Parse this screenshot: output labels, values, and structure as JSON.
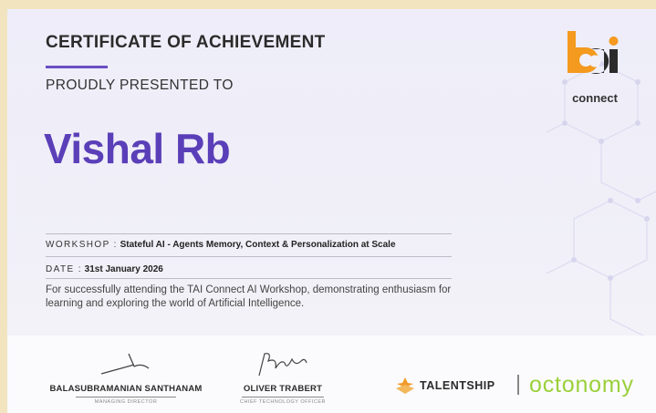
{
  "certificate": {
    "title": "CERTIFICATE OF ACHIEVEMENT",
    "subtitle": "PROUDLY PRESENTED TO",
    "recipient": "Vishal Rb",
    "workshop_label": "WORKSHOP :",
    "workshop_value": "Stateful AI - Agents Memory, Context & Personalization at Scale",
    "date_label": "DATE :",
    "date_value": "31st January 2026",
    "description": "For successfully attending the TAI Connect AI Workshop, demonstrating enthusiasm for learning and exploring the world of Artificial Intelligence."
  },
  "logo": {
    "text": "connect",
    "icon": "tai-logo-icon",
    "colors": {
      "orange": "#f39a1f",
      "dark": "#2b2b2b"
    }
  },
  "signatures": [
    {
      "name": "BALASUBRAMANIAN SANTHANAM",
      "role": "MANAGING DIRECTOR"
    },
    {
      "name": "OLIVER TRABERT",
      "role": "CHIEF TECHNOLOGY OFFICER"
    }
  ],
  "partners": {
    "talentship": "TALENTSHIP",
    "octonomy": "octonomy"
  },
  "colors": {
    "accent": "#5a3fb8",
    "background": "#f1e4bf",
    "octonomy": "#9ad03a"
  }
}
